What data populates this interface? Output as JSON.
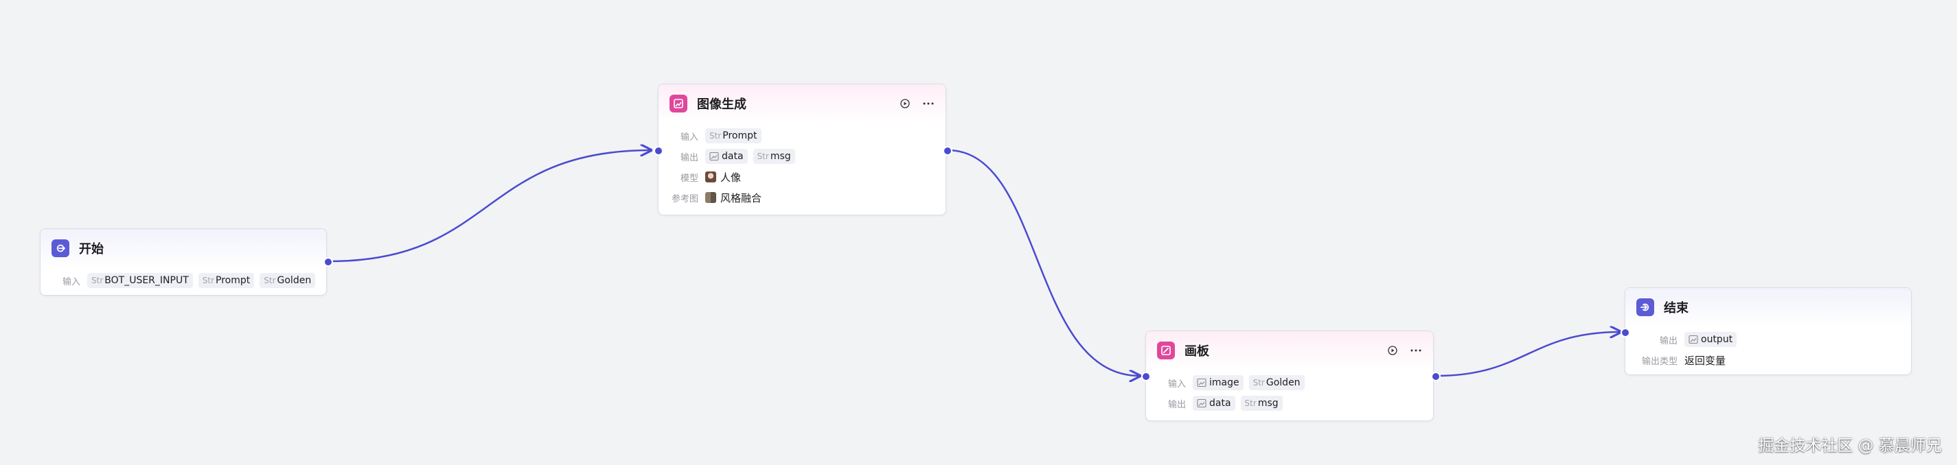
{
  "colors": {
    "accent": "#4a4bcf",
    "start_end_icon": "#5b5bd6",
    "tool_icon": "#e0479b",
    "tag_bg": "#eff0f5",
    "canvas_bg": "#f2f3f5"
  },
  "nodes": {
    "start": {
      "title": "开始",
      "icon": "start-arrow-icon",
      "rows": [
        {
          "label": "输入",
          "tags": [
            {
              "type": "Str",
              "name": "BOT_USER_INPUT"
            },
            {
              "type": "Str",
              "name": "Prompt"
            },
            {
              "type": "Str",
              "name": "Golden"
            }
          ]
        }
      ]
    },
    "imagegen": {
      "title": "图像生成",
      "icon": "image-generate-icon",
      "rows": [
        {
          "label": "输入",
          "tags": [
            {
              "type": "Str",
              "name": "Prompt"
            }
          ]
        },
        {
          "label": "输出",
          "tags": [
            {
              "type": "image",
              "name": "data"
            },
            {
              "type": "Str",
              "name": "msg"
            }
          ]
        },
        {
          "label": "模型",
          "value": "人像"
        },
        {
          "label": "参考图",
          "value": "风格融合"
        }
      ]
    },
    "canvas": {
      "title": "画板",
      "icon": "canvas-board-icon",
      "rows": [
        {
          "label": "输入",
          "tags": [
            {
              "type": "image",
              "name": "image"
            },
            {
              "type": "Str",
              "name": "Golden"
            }
          ]
        },
        {
          "label": "输出",
          "tags": [
            {
              "type": "image",
              "name": "data"
            },
            {
              "type": "Str",
              "name": "msg"
            }
          ]
        }
      ]
    },
    "end": {
      "title": "结束",
      "icon": "end-arrow-icon",
      "rows": [
        {
          "label": "输出",
          "tags": [
            {
              "type": "image",
              "name": "output"
            }
          ]
        },
        {
          "label": "输出类型",
          "value": "返回变量"
        }
      ]
    }
  },
  "watermark": "掘金技术社区 @ 慕晨师兄"
}
